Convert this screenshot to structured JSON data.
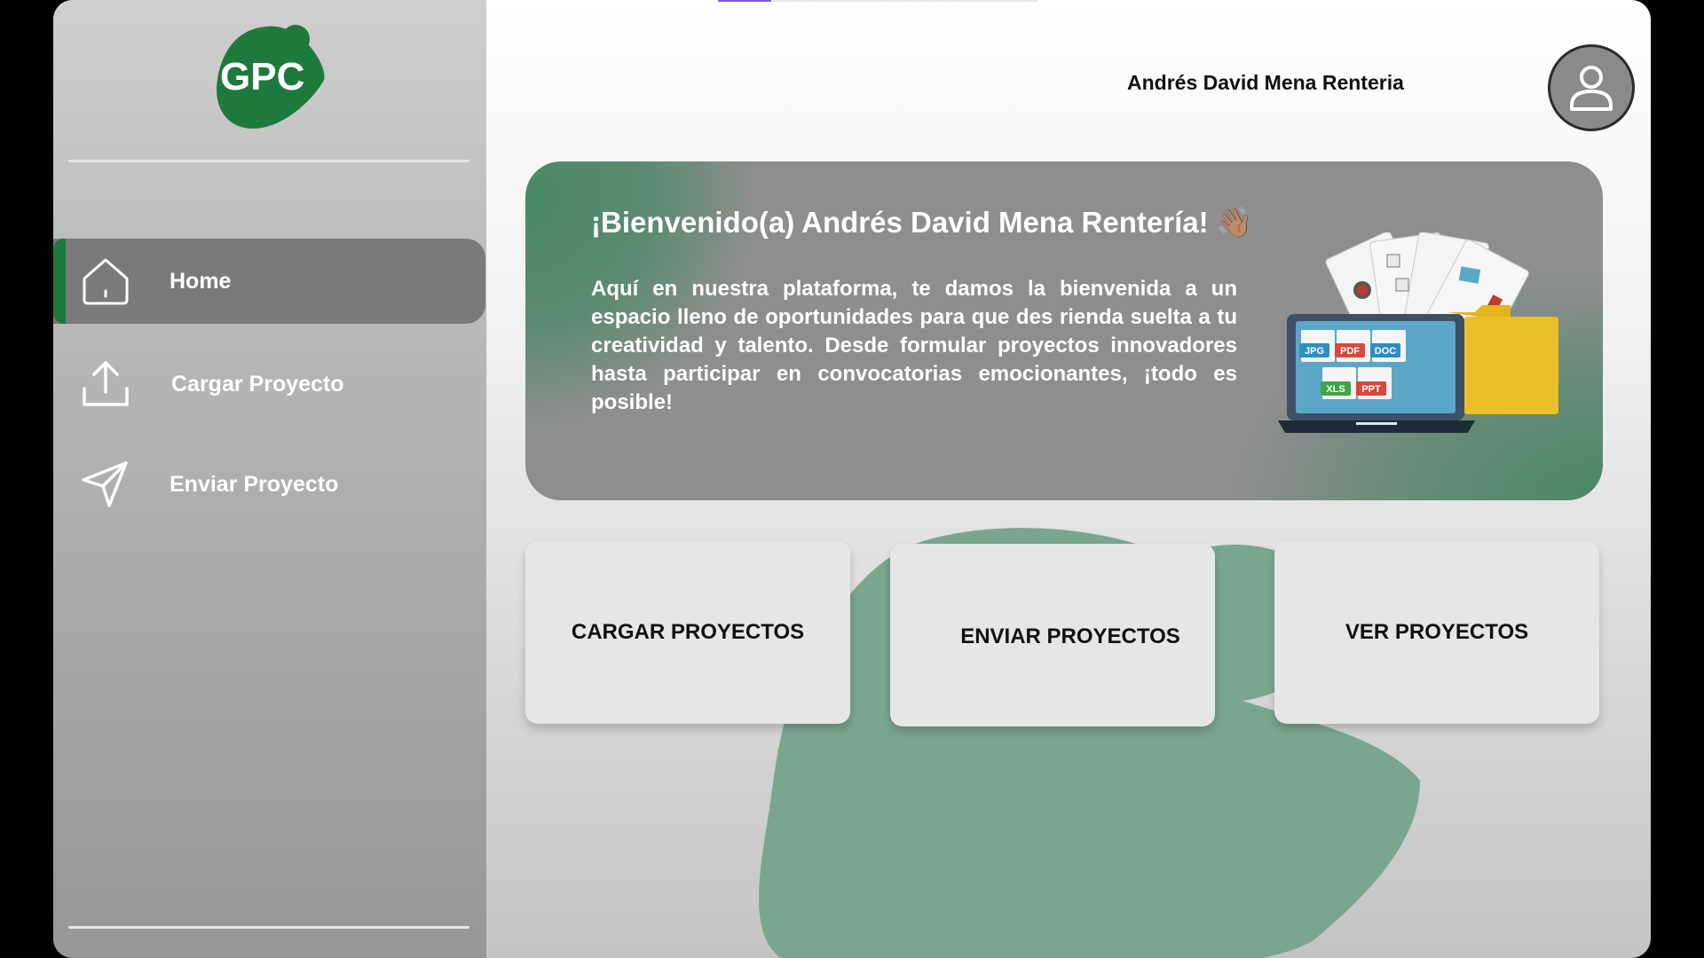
{
  "app": {
    "logo_text": "GPC",
    "brand_color": "#1e7a3c"
  },
  "sidebar": {
    "items": [
      {
        "label": "Home",
        "icon": "home-icon",
        "active": true
      },
      {
        "label": "Cargar Proyecto",
        "icon": "upload-icon",
        "active": false
      },
      {
        "label": "Enviar Proyecto",
        "icon": "send-icon",
        "active": false
      }
    ]
  },
  "header": {
    "user_name": "Andrés David Mena Renteria",
    "avatar_icon": "user-icon"
  },
  "banner": {
    "title": "¡Bienvenido(a) Andrés David Mena Rentería! 👋🏽",
    "text": "Aquí en nuestra plataforma, te damos la bienvenida a un espacio lleno de oportunidades para que des rienda suelta a tu creatividad y talento. Desde formular proyectos innovadores hasta participar en convocatorias emocionantes, ¡todo es posible!",
    "illustration": {
      "file_tags": [
        "JPG",
        "PDF",
        "DOC",
        "XLS",
        "PPT"
      ]
    }
  },
  "cards": [
    {
      "label": "CARGAR PROYECTOS"
    },
    {
      "label": "ENVIAR PROYECTOS"
    },
    {
      "label": "VER PROYECTOS"
    }
  ],
  "colors": {
    "accent_green": "#1e7a3c",
    "banner_green": "#4a8a66",
    "blob_green": "#7aa690"
  }
}
